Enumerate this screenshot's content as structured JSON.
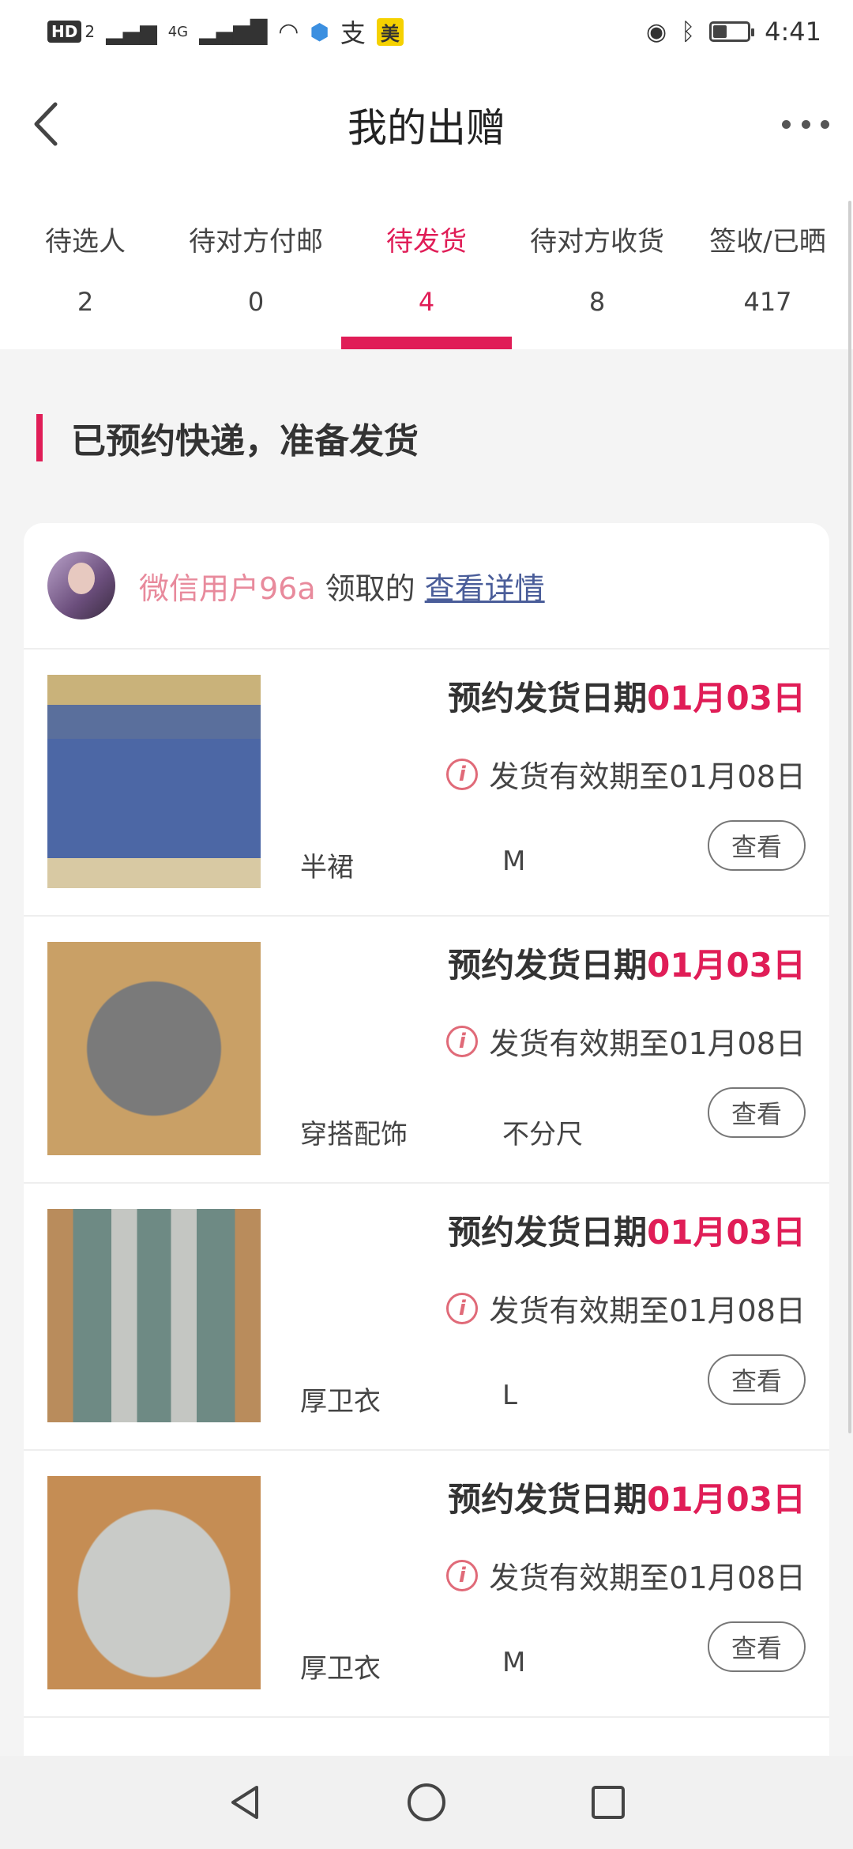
{
  "status_bar": {
    "hd_badge": "HD",
    "sim": "2",
    "network": "4G",
    "pay_app": "支",
    "app_badge": "美",
    "time": "4:41",
    "battery_level": 0.4
  },
  "header": {
    "title": "我的出赠",
    "back_icon": "chevron-left-icon",
    "more_icon": "more-horizontal-icon"
  },
  "tabs": [
    {
      "label": "待选人",
      "count": "2"
    },
    {
      "label": "待对方付邮",
      "count": "0"
    },
    {
      "label": "待发货",
      "count": "4",
      "active": true
    },
    {
      "label": "待对方收货",
      "count": "8"
    },
    {
      "label": "签收/已晒",
      "count": "417"
    }
  ],
  "section_title": "已预约快递，准备发货",
  "recipient": {
    "username": "微信用户96a",
    "claimed_label": "领取的",
    "details_link": "查看详情"
  },
  "items": [
    {
      "date_label": "预约发货日期",
      "date": "01月03日",
      "validity": "发货有效期至01月08日",
      "category": "半裙",
      "size": "M",
      "view_label": "查看"
    },
    {
      "date_label": "预约发货日期",
      "date": "01月03日",
      "validity": "发货有效期至01月08日",
      "category": "穿搭配饰",
      "size": "不分尺",
      "view_label": "查看"
    },
    {
      "date_label": "预约发货日期",
      "date": "01月03日",
      "validity": "发货有效期至01月08日",
      "category": "厚卫衣",
      "size": "L",
      "view_label": "查看"
    },
    {
      "date_label": "预约发货日期",
      "date": "01月03日",
      "validity": "发货有效期至01月08日",
      "category": "厚卫衣",
      "size": "M",
      "view_label": "查看"
    }
  ],
  "colors": {
    "accent": "#e01d57",
    "username": "#e88a9c",
    "link": "#4a5d99"
  },
  "nav": [
    "back-triangle-icon",
    "home-circle-icon",
    "recents-square-icon"
  ]
}
